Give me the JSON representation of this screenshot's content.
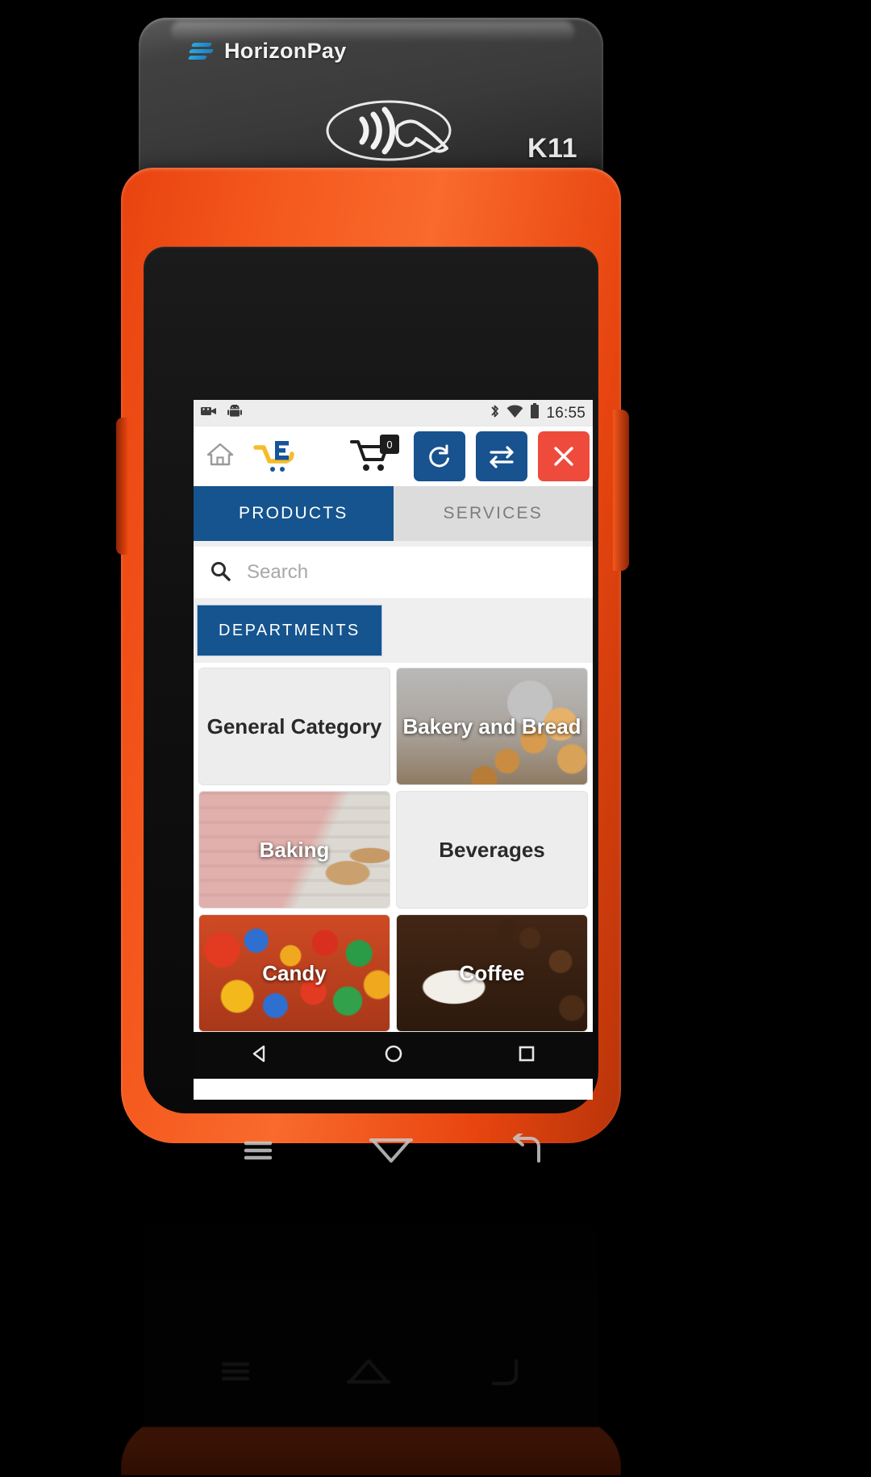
{
  "device": {
    "brand": "HorizonPay",
    "model": "K11",
    "brand_logo_icon": "horizonpay-logo-icon",
    "nfc_icon": "nfc-contactless-icon"
  },
  "status_bar": {
    "time": "16:55",
    "left_icons": [
      {
        "name": "screen-record-icon"
      },
      {
        "name": "android-robot-icon"
      }
    ],
    "right_icons": [
      {
        "name": "bluetooth-icon"
      },
      {
        "name": "wifi-icon"
      },
      {
        "name": "battery-icon"
      }
    ]
  },
  "app_bar": {
    "home_icon": "home-icon",
    "logo_icon": "shopping-cart-logo-icon",
    "cart_icon": "shopping-cart-icon",
    "cart_count": "0",
    "actions": [
      {
        "name": "sync-button",
        "icon": "sync-refresh-icon",
        "color": "#18528f"
      },
      {
        "name": "transfer-button",
        "icon": "swap-arrows-icon",
        "color": "#18528f"
      },
      {
        "name": "close-button",
        "icon": "close-x-icon",
        "color": "#ee4b3c"
      }
    ]
  },
  "tabs": [
    {
      "label": "PRODUCTS",
      "active": true
    },
    {
      "label": "SERVICES",
      "active": false
    }
  ],
  "search": {
    "placeholder": "Search",
    "value": "",
    "icon": "search-icon"
  },
  "departments": {
    "header_label": "DEPARTMENTS",
    "items": [
      {
        "label": "General Category",
        "style": "plain",
        "label_color": "dark"
      },
      {
        "label": "Bakery and Bread",
        "style": "bakery",
        "label_color": "light"
      },
      {
        "label": "Baking",
        "style": "baking",
        "label_color": "light"
      },
      {
        "label": "Beverages",
        "style": "plain",
        "label_color": "dark"
      },
      {
        "label": "Candy",
        "style": "candy",
        "label_color": "light"
      },
      {
        "label": "Coffee",
        "style": "coffee",
        "label_color": "light"
      }
    ]
  },
  "nav_bar": [
    {
      "name": "back-nav-icon"
    },
    {
      "name": "home-nav-icon"
    },
    {
      "name": "recents-nav-icon"
    }
  ],
  "capacitive_buttons": [
    {
      "name": "menu-key-icon"
    },
    {
      "name": "home-key-icon"
    },
    {
      "name": "back-key-icon"
    }
  ],
  "colors": {
    "accent_blue": "#15548e",
    "close_red": "#ee4b3c",
    "chassis_orange": "#f4571c",
    "tab_inactive_bg": "#dcdcdc",
    "logo_yellow": "#f5bc2a",
    "logo_blue": "#17549a"
  }
}
